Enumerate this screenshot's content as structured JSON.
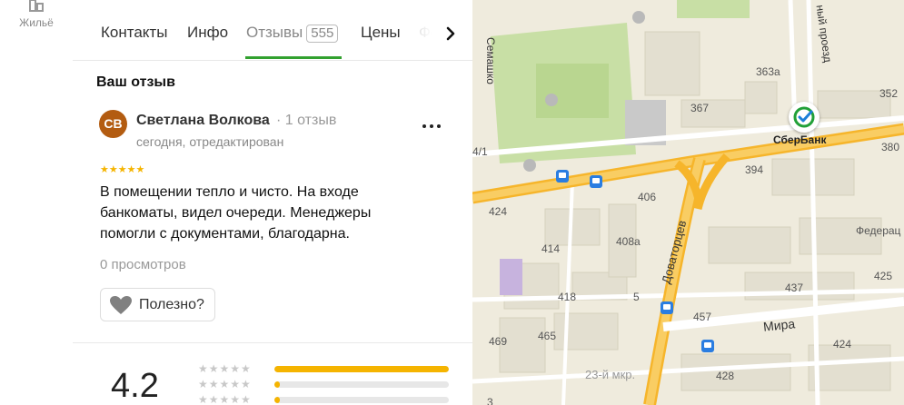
{
  "rail": {
    "housing_label": "Жильё",
    "housing_icon": "house-icon"
  },
  "tabs": [
    {
      "label": "Контакты"
    },
    {
      "label": "Инфо"
    },
    {
      "label": "Отзывы",
      "count": "555"
    },
    {
      "label": "Цены"
    },
    {
      "label": "Фо"
    }
  ],
  "active_tab": "Отзывы",
  "review": {
    "section_title": "Ваш отзыв",
    "avatar_initials": "СВ",
    "avatar_color": "#b35c11",
    "author": "Светлана Волкова",
    "author_reviews": "1 отзыв",
    "date": "сегодня, отредактирован",
    "stars": "★★★★★",
    "rating": 5,
    "text": "В помещении тепло и чисто. На входе банкоматы, видел очереди. Менеджеры помогли с документами, благодарна.",
    "views": "0 просмотров",
    "useful_label": "Полезно?"
  },
  "summary": {
    "rating": "4.2",
    "distribution": [
      {
        "stars": "★★★★★",
        "share": 1.0
      },
      {
        "stars": "★★★★★",
        "share": 0.03
      },
      {
        "stars": "★★★★★",
        "share": 0.03
      }
    ]
  },
  "map": {
    "sber_label": "СберБанк",
    "federal_label": "Федерац",
    "streets": {
      "dovatortsev": "Доваторцев",
      "mira": "Мира",
      "semashko": "Семашко",
      "proezd": "ный проезд"
    },
    "district_label": "23-й мкр.",
    "buildings": [
      "367",
      "363а",
      "352",
      "380",
      "394",
      "424",
      "406",
      "414",
      "408а",
      "418",
      "465",
      "469",
      "5",
      "457",
      "437",
      "425",
      "424",
      "428",
      "4/1",
      "3"
    ]
  },
  "colors": {
    "accent_green": "#32a12f",
    "star_yellow": "#f5b400",
    "road_orange": "#f6b52b",
    "sber_green": "#21a038"
  }
}
